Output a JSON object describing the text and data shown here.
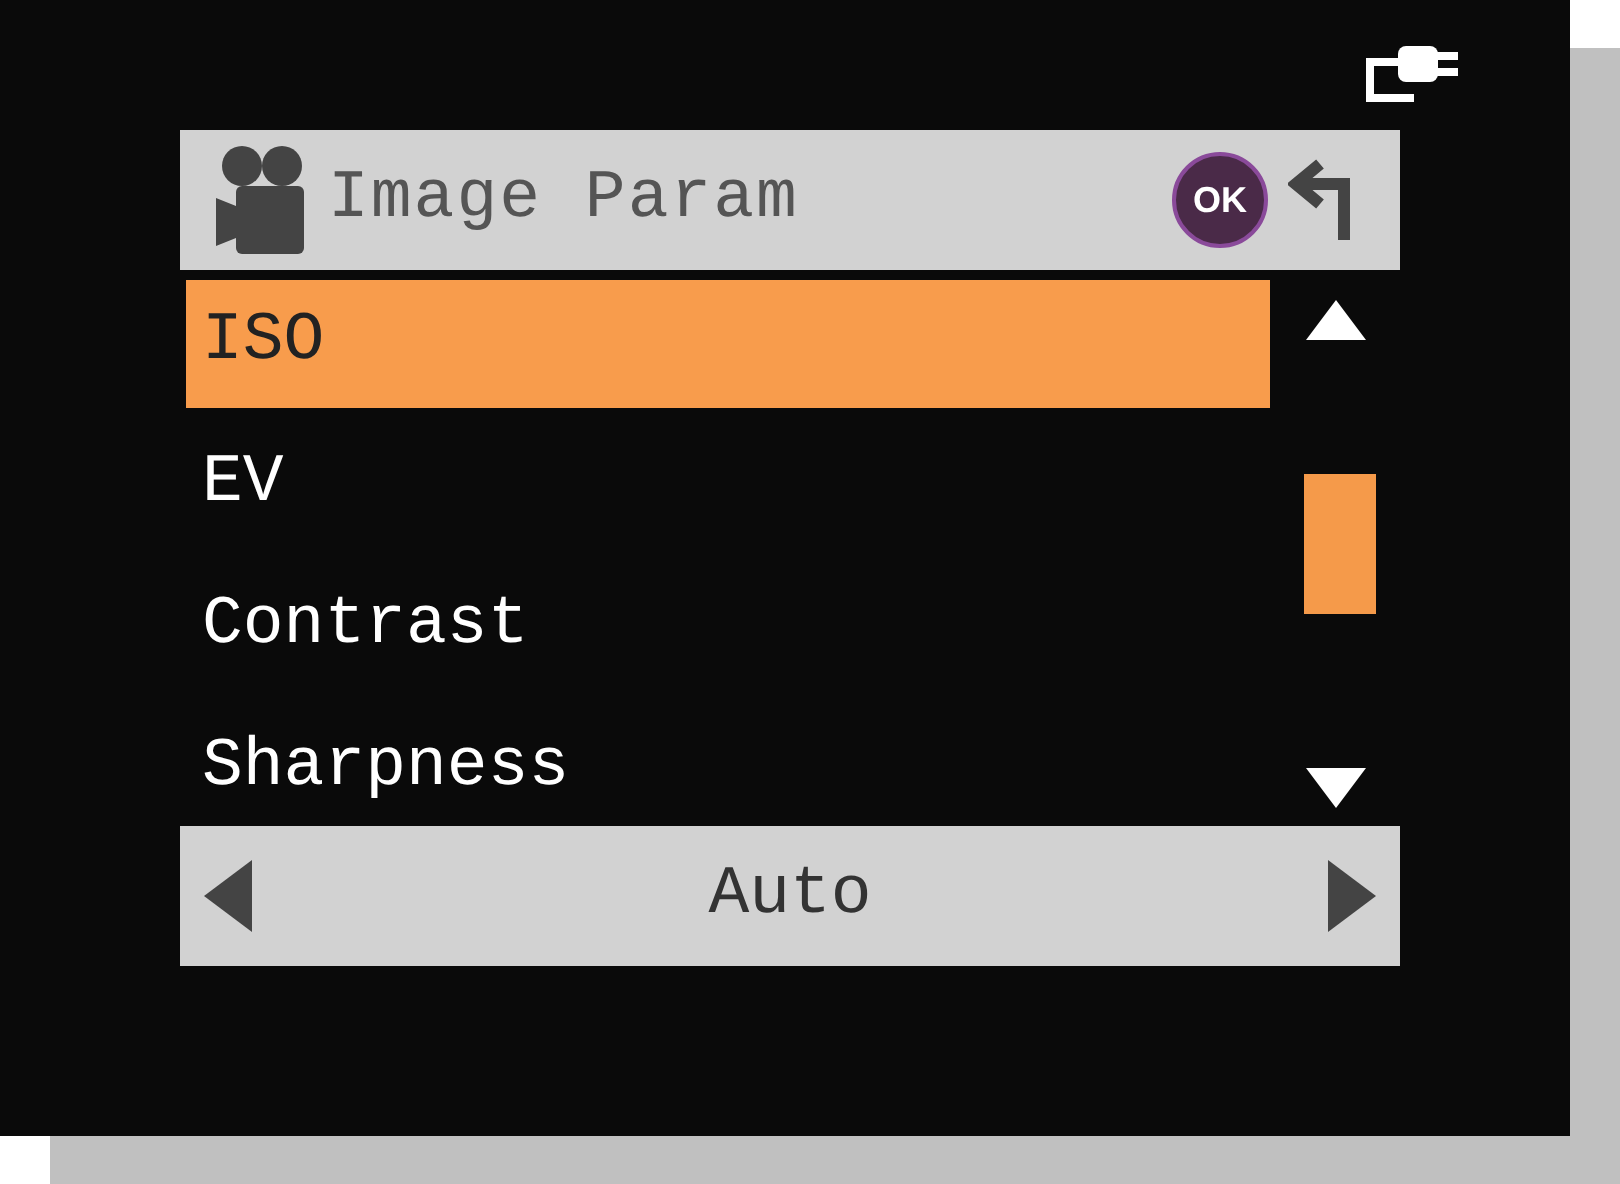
{
  "header": {
    "title": "Image Param",
    "ok_label": "OK"
  },
  "menu": [
    {
      "label": "ISO",
      "selected": true
    },
    {
      "label": "EV",
      "selected": false
    },
    {
      "label": "Contrast",
      "selected": false
    },
    {
      "label": "Sharpness",
      "selected": false
    }
  ],
  "value_bar": {
    "value": "Auto"
  }
}
